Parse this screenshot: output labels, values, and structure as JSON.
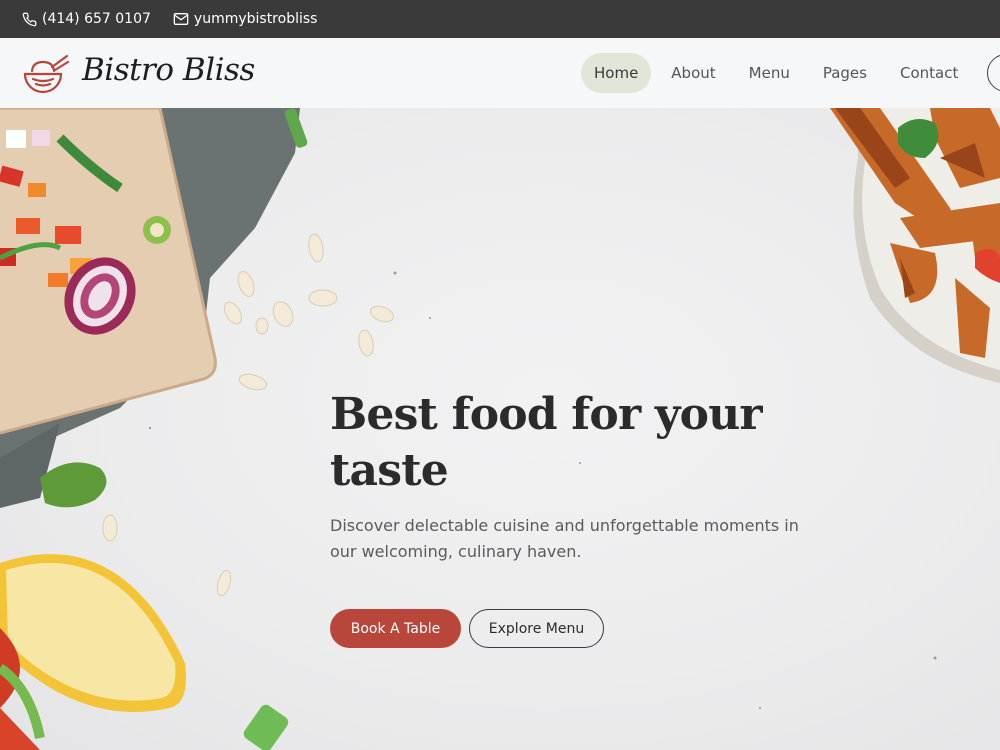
{
  "topbar": {
    "phone": "(414) 657 0107",
    "email": "yummybistrobliss",
    "icons": [
      "phone-icon",
      "envelope-icon"
    ]
  },
  "header": {
    "brand": "Bistro Bliss",
    "logo_icon": "bowl-with-chopsticks-icon",
    "nav": [
      {
        "label": "Home",
        "active": true
      },
      {
        "label": "About",
        "active": false
      },
      {
        "label": "Menu",
        "active": false
      },
      {
        "label": "Pages",
        "active": false
      },
      {
        "label": "Contact",
        "active": false
      }
    ]
  },
  "hero": {
    "title": "Best food for your taste",
    "subtitle": "Discover delectable cuisine and unforgettable moments in our welcoming, culinary haven.",
    "primary_button": "Book A Table",
    "secondary_button": "Explore Menu"
  },
  "colors": {
    "topbar_bg": "#3a3a3a",
    "header_bg": "#f6f7f9",
    "nav_active_bg": "#e1e6d8",
    "accent": "#b9463a",
    "hero_bg": "#ebebeb"
  }
}
